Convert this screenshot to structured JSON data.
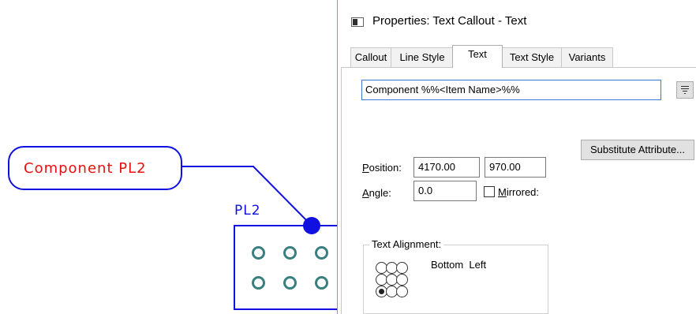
{
  "canvas": {
    "callout_text": "Component PL2",
    "ref_designator": "PL2",
    "colors": {
      "outline": "#1010e0",
      "callout_text": "#e81010",
      "pads": "#3a7f7f"
    }
  },
  "dialog": {
    "title": "Properties: Text Callout - Text",
    "tabs": [
      {
        "label": "Callout"
      },
      {
        "label": "Line Style"
      },
      {
        "label": "Text",
        "active": true
      },
      {
        "label": "Text Style"
      },
      {
        "label": "Variants"
      }
    ],
    "text_value": "Component %%<Item Name>%%",
    "substitute_button": "Substitute Attribute...",
    "position": {
      "label_mnemonic": "P",
      "label_rest": "osition:",
      "x": "4170.00",
      "y": "970.00"
    },
    "angle": {
      "label_mnemonic": "A",
      "label_rest": "ngle:",
      "value": "0.0"
    },
    "mirrored": {
      "label_mnemonic": "M",
      "label_rest": "irrored:",
      "checked": false
    },
    "alignment": {
      "caption": "Text Alignment:",
      "selected_text": "Bottom  Left",
      "grid": [
        [
          false,
          false,
          false
        ],
        [
          false,
          false,
          false
        ],
        [
          true,
          false,
          false
        ]
      ]
    }
  }
}
